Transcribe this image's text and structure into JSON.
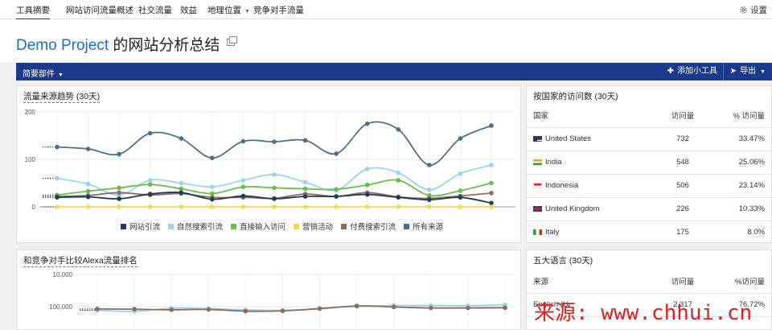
{
  "nav": {
    "tabs": [
      "工具摘要",
      "网站访问流量概述",
      "社交流量",
      "效益",
      "地理位置",
      "竞争对手流量"
    ],
    "settings": "设置"
  },
  "header": {
    "project": "Demo Project",
    "title_suffix": " 的网站分析总结"
  },
  "toolbar": {
    "summary_widget": "简要部件",
    "add_widget": "添加小工具",
    "export": "导出"
  },
  "traffic_panel": {
    "title": "流量来源趋势 (30天)",
    "legend": [
      "网站引流",
      "自然搜索引流",
      "直接输入访问",
      "营销活动",
      "付费搜索引流",
      "所有来源"
    ]
  },
  "colors": {
    "referral": "#1f3c5a",
    "organic": "#9ad4ea",
    "direct": "#6cbb4a",
    "campaign": "#f0d84a",
    "paid": "#8c6b62",
    "all": "#4f6f86",
    "brand": "#1c3a8c"
  },
  "chart_data": [
    {
      "type": "line",
      "title": "流量来源趋势 (30天)",
      "ylim": [
        0,
        200
      ],
      "yticks": [
        0,
        100,
        200
      ],
      "grid": true,
      "legend_position": "bottom",
      "series": [
        {
          "name": "所有来源",
          "color": "#4f6f86",
          "values": [
            126,
            122,
            111,
            155,
            144,
            103,
            138,
            137,
            140,
            112,
            175,
            163,
            88,
            144,
            171
          ]
        },
        {
          "name": "自然搜索引流",
          "color": "#9ad4ea",
          "values": [
            60,
            48,
            25,
            56,
            50,
            42,
            56,
            68,
            52,
            35,
            80,
            72,
            36,
            70,
            88
          ]
        },
        {
          "name": "直接输入访问",
          "color": "#6cbb4a",
          "values": [
            25,
            33,
            40,
            47,
            38,
            28,
            42,
            40,
            38,
            37,
            46,
            56,
            24,
            34,
            50
          ]
        },
        {
          "name": "付费搜索引流",
          "color": "#8c6b62",
          "values": [
            22,
            24,
            30,
            25,
            28,
            20,
            20,
            18,
            27,
            22,
            30,
            21,
            18,
            23,
            29
          ]
        },
        {
          "name": "网站引流",
          "color": "#1f3c5a",
          "values": [
            20,
            21,
            17,
            27,
            30,
            16,
            23,
            17,
            22,
            22,
            26,
            20,
            15,
            20,
            8
          ]
        },
        {
          "name": "营销活动",
          "color": "#f0d84a",
          "values": [
            0,
            0,
            0,
            0,
            0,
            0,
            0,
            0,
            0,
            0,
            0,
            0,
            0,
            0,
            0
          ]
        }
      ]
    },
    {
      "type": "line",
      "title": "和竞争对手比较Alexa流量排名",
      "yticks": [
        "10,000",
        "100,000"
      ],
      "grid": true,
      "series": [
        {
          "color": "#9ad4ea",
          "values": [
            130000,
            140000,
            112000,
            115000,
            125000,
            130000,
            115000,
            98000,
            92000,
            92000,
            93000,
            88000
          ]
        },
        {
          "color": "#8c6b62",
          "values": [
            118000,
            120000,
            125000,
            122000,
            138000,
            135000,
            115000,
            95000,
            102000,
            110000,
            110000,
            108000
          ]
        }
      ]
    }
  ],
  "country_panel": {
    "title": "按国家的访问数 (30天)",
    "headers": [
      "国家",
      "访问量",
      "% 访问量"
    ],
    "rows": [
      {
        "name": "United States",
        "visits": "732",
        "pct": "33.47%"
      },
      {
        "name": "India",
        "visits": "548",
        "pct": "25.06%"
      },
      {
        "name": "Indonesia",
        "visits": "506",
        "pct": "23.14%"
      },
      {
        "name": "United Kingdom",
        "visits": "226",
        "pct": "10.33%"
      },
      {
        "name": "Italy",
        "visits": "175",
        "pct": "8.0%"
      }
    ]
  },
  "alexa_panel": {
    "title": "和竞争对手比较Alexa流量排名"
  },
  "language_panel": {
    "title": "五大语言 (30天)",
    "headers": [
      "来源",
      "访问量",
      "%访问量"
    ],
    "rows": [
      {
        "name": "English (U",
        "visits": "2,317",
        "pct": "76.72%"
      }
    ]
  },
  "watermark": "来源: www.chhui.cn"
}
